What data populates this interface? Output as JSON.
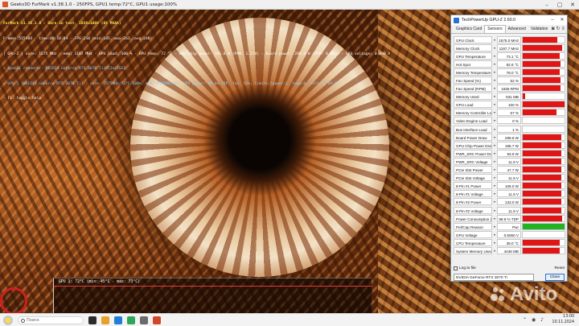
{
  "furmark": {
    "title": "Geeks3D FurMark v1.38.1.0 - 250FPS, GPU1 temp:72°C, GPU1 usage:100%",
    "osd": [
      "FurMark v1.38.1.0 - Burn-in test, 1920x1080 (0X MSAA)",
      "Frames:515984 - time:00:18:09 - FPS:250 (min:185, max:263, avg:248)",
      "[ GPU-Z ] core: 1575 MHz - mem: 1187 MHz - GPU load: 100 % - GPU temp: 72 °C - GPU chip power: 195.8 W (PPW: 1.278) - Board power: 289.8 W (PPW: 0.863) - GPU voltage: 0.800 V",
      "> OpenGL renderer: NVIDIA GeForce RTX 3070 Ti/PCIe/SSE2",
      "> GPU 1 (NVIDIA GeForce RTX 3070 Ti) - core: 1575MHz/72°C/100%, mem: 9501MHz/7%, GPU power: 98.6% TDP, fan: 52%, limits:[power:1, temp:0, volt:0, OV:0]",
      "- F1: toggle help"
    ],
    "graph_label": "GPU 1: 72°C (min: 45°C - max: 73°C)"
  },
  "gpuz": {
    "title": "TechPowerUp GPU-Z 2.60.0",
    "tabs": [
      "Graphics Card",
      "Sensors",
      "Advanced",
      "Validation"
    ],
    "active_tab": "Sensors",
    "rows": [
      {
        "name": "GPU Clock",
        "value": "1575.0 MHz",
        "level": 0.82
      },
      {
        "name": "Memory Clock",
        "value": "1187.7 MHz",
        "level": 0.95
      },
      {
        "name": "GPU Temperature",
        "value": "73.1 °C",
        "level": 0.88
      },
      {
        "name": "Hot Spot",
        "value": "82.6 °C",
        "level": 0.9
      },
      {
        "name": "Memory Temperature",
        "value": "78.0 °C",
        "level": 0.88
      },
      {
        "name": "Fan Speed (%)",
        "value": "52 %",
        "level": 0.9
      },
      {
        "name": "Fan Speed (RPM)",
        "value": "1835 RPM",
        "level": 0.9
      },
      {
        "name": "Memory Used",
        "value": "631 MB",
        "level": 0.05
      },
      {
        "name": "GPU Load",
        "value": "100 %",
        "level": 1.0
      },
      {
        "name": "Memory Controller Load",
        "value": "67 %",
        "level": 0.8
      },
      {
        "name": "Video Engine Load",
        "value": "0 %",
        "level": 0.0
      },
      {
        "name": "Bus Interface Load",
        "value": "1 %",
        "level": 0.0
      },
      {
        "name": "Board Power Draw",
        "value": "289.8 W",
        "level": 0.92
      },
      {
        "name": "GPU Chip Power Draw",
        "value": "195.7 W",
        "level": 0.92
      },
      {
        "name": "PWR_SRC Power Draw",
        "value": "93.9 W",
        "level": 0.92
      },
      {
        "name": "PWR_SRC Voltage",
        "value": "11.9 V",
        "level": 0.92
      },
      {
        "name": "PCIe Slot Power",
        "value": "47.7 W",
        "level": 0.92
      },
      {
        "name": "PCIe Slot Voltage",
        "value": "11.9 V",
        "level": 0.92
      },
      {
        "name": "8-Pin #1 Power",
        "value": "109.0 W",
        "level": 0.92
      },
      {
        "name": "8-Pin #1 Voltage",
        "value": "11.9 V",
        "level": 0.92
      },
      {
        "name": "8-Pin #2 Power",
        "value": "133.0 W",
        "level": 0.92
      },
      {
        "name": "8-Pin #2 Voltage",
        "value": "11.9 V",
        "level": 0.92
      },
      {
        "name": "Power Consumption (%)",
        "value": "99.9 % TDP",
        "level": 0.95
      },
      {
        "name": "PerfCap Reason",
        "value": "Pwr",
        "level": 1.0,
        "color": "#21b321"
      },
      {
        "name": "GPU Voltage",
        "value": "0.8060 V",
        "level": 0.0
      },
      {
        "name": "CPU Temperature",
        "value": "39.0 °C",
        "level": 0.88
      },
      {
        "name": "System Memory Used",
        "value": "4436 MB",
        "level": 0.88
      }
    ],
    "log_label": "Log to file",
    "reset_label": "Reset",
    "selected_gpu": "NVIDIA GeForce RTX 3070 Ti",
    "close_label": "Close",
    "bar_color": "#e01515"
  },
  "taskbar": {
    "search_placeholder": "Поиск",
    "time": "13:00",
    "date": "10.11.2024"
  },
  "watermark": "Avito"
}
